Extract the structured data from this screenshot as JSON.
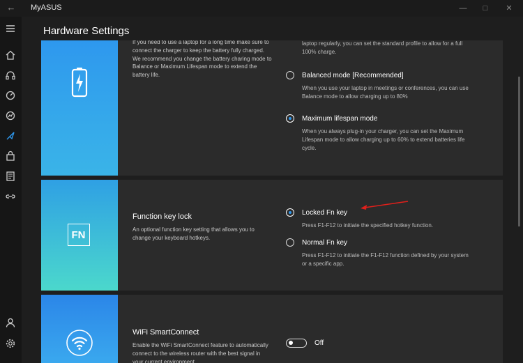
{
  "app": {
    "title": "MyASUS"
  },
  "header": {
    "title": "Hardware Settings"
  },
  "battery_card": {
    "desc": "If you need to use a laptop for a long time make sure to connect the charger to keep the battery fully charged. We recommend you change the battery charing mode to Balance or Maximum Lifespan mode to extend the battery life.",
    "top_partial_text": "laptop regularly, you can set the standard profile to allow for a full 100% charge.",
    "options": [
      {
        "label": "Balanced mode [Recommended]",
        "desc": "When you use your laptop in meetings or conferences, you can use Balance mode to allow charging up to 80%",
        "checked": false
      },
      {
        "label": "Maximum lifespan mode",
        "desc": "When you always plug-in your charger, you can set the Maximum Lifespan mode to allow charging up to 60% to extend batteries life cycle.",
        "checked": true
      }
    ]
  },
  "fn_card": {
    "title": "Function key lock",
    "desc": "An optional function key setting that allows you to change your keyboard hotkeys.",
    "tile_text": "FN",
    "options": [
      {
        "label": "Locked Fn key",
        "desc": "Press F1-F12 to initiate the specified hotkey function.",
        "checked": true
      },
      {
        "label": "Normal Fn key",
        "desc": "Press F1-F12 to initiate the F1-F12 function defined by your system or a specific app.",
        "checked": false
      }
    ]
  },
  "wifi_card": {
    "title": "WiFi SmartConnect",
    "desc": "Enable the WiFi SmartConnect feature to automatically connect to the wireless router with the best signal in your current environment.",
    "toggle_label": "Off",
    "toggle_on": false
  },
  "colors": {
    "accent": "#2e98ee",
    "annotation_arrow": "#e0201b"
  }
}
